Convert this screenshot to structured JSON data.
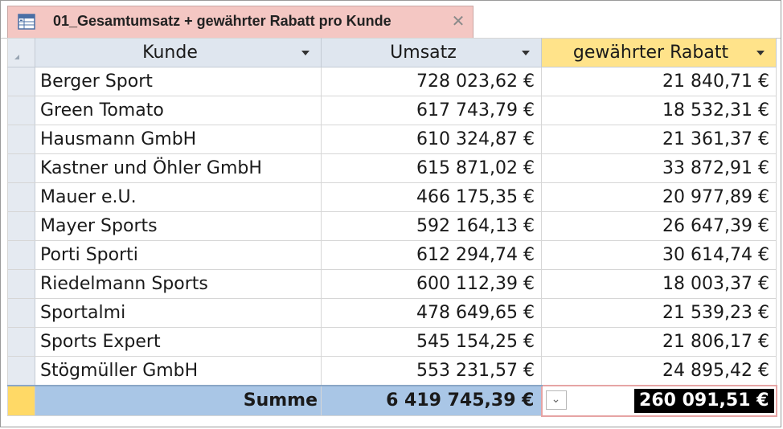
{
  "tab": {
    "title": "01_Gesamtumsatz + gewährter Rabatt pro Kunde",
    "close_glyph": "✕"
  },
  "columns": [
    {
      "label": "Kunde"
    },
    {
      "label": "Umsatz"
    },
    {
      "label": "gewährter Rabatt"
    }
  ],
  "rows": [
    {
      "kunde": "Berger Sport",
      "umsatz": "728 023,62 €",
      "rabatt": "21 840,71 €"
    },
    {
      "kunde": "Green Tomato",
      "umsatz": "617 743,79 €",
      "rabatt": "18 532,31 €"
    },
    {
      "kunde": "Hausmann GmbH",
      "umsatz": "610 324,87 €",
      "rabatt": "21 361,37 €"
    },
    {
      "kunde": "Kastner und Öhler GmbH",
      "umsatz": "615 871,02 €",
      "rabatt": "33 872,91 €"
    },
    {
      "kunde": "Mauer e.U.",
      "umsatz": "466 175,35 €",
      "rabatt": "20 977,89 €"
    },
    {
      "kunde": "Mayer Sports",
      "umsatz": "592 164,13 €",
      "rabatt": "26 647,39 €"
    },
    {
      "kunde": "Porti Sporti",
      "umsatz": "612 294,74 €",
      "rabatt": "30 614,74 €"
    },
    {
      "kunde": "Riedelmann Sports",
      "umsatz": "600 112,39 €",
      "rabatt": "18 003,37 €"
    },
    {
      "kunde": "Sportalmi",
      "umsatz": "478 649,65 €",
      "rabatt": "21 539,23 €"
    },
    {
      "kunde": "Sports Expert",
      "umsatz": "545 154,25 €",
      "rabatt": "21 806,17 €"
    },
    {
      "kunde": "Stögmüller GmbH",
      "umsatz": "553 231,57 €",
      "rabatt": "24 895,42 €"
    }
  ],
  "totals": {
    "label": "Summe",
    "umsatz": "6 419 745,39 €",
    "rabatt": "260 091,51 €",
    "combo_glyph": "⌄"
  },
  "colors": {
    "tab_background": "#f4c7c3",
    "header_background": "#dfe6ef",
    "highlight_header": "#ffe38a",
    "total_row": "#a9c6e6",
    "total_selector": "#ffd966"
  }
}
